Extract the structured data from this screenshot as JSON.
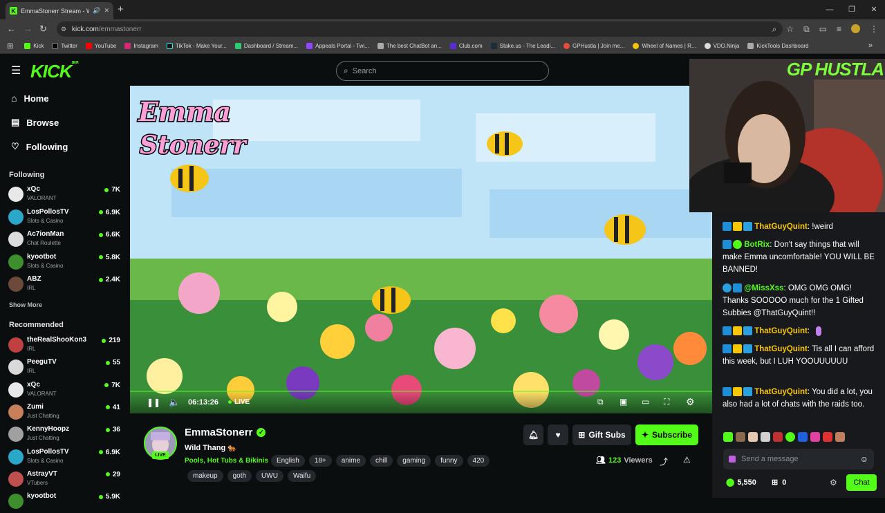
{
  "browser": {
    "tab_title": "EmmaStonerr Stream - Wat",
    "new_tab": "+",
    "url_host": "kick.com",
    "url_path": "/emmastonerr",
    "bookmarks": [
      "Kick",
      "Twitter",
      "YouTube",
      "Instagram",
      "TikTok - Make Your...",
      "Dashboard / Stream...",
      "Appeals Portal - Twi...",
      "The best ChatBot an...",
      "Club.com",
      "Stake.us - The Leadi...",
      "GPHustla | Join me...",
      "Wheel of Names | R...",
      "VDO.Ninja",
      "KickTools Dashboard"
    ]
  },
  "header": {
    "logo": "KICK",
    "logo_beta": "BETA",
    "search_placeholder": "Search"
  },
  "sidebar": {
    "nav": [
      {
        "label": "Home",
        "icon": "home-icon"
      },
      {
        "label": "Browse",
        "icon": "browse-icon"
      },
      {
        "label": "Following",
        "icon": "heart-icon"
      }
    ],
    "following_title": "Following",
    "following": [
      {
        "name": "xQc",
        "category": "VALORANT",
        "viewers": "7K",
        "color": "#e8e8e8"
      },
      {
        "name": "LosPollosTV",
        "category": "Slots & Casino",
        "viewers": "6.9K",
        "color": "#2aa7c9"
      },
      {
        "name": "Ac7ionMan",
        "category": "Chat Roulette",
        "viewers": "6.6K",
        "color": "#dddddd"
      },
      {
        "name": "kyootbot",
        "category": "Slots & Casino",
        "viewers": "5.8K",
        "color": "#3c8f2c"
      },
      {
        "name": "ABZ",
        "category": "IRL",
        "viewers": "2.4K",
        "color": "#6b4a3a"
      }
    ],
    "show_more": "Show More",
    "recommended_title": "Recommended",
    "recommended": [
      {
        "name": "theRealShooKon3",
        "category": "IRL",
        "viewers": "219",
        "color": "#c04040"
      },
      {
        "name": "PeeguTV",
        "category": "IRL",
        "viewers": "55",
        "color": "#d9d9d9"
      },
      {
        "name": "xQc",
        "category": "VALORANT",
        "viewers": "7K",
        "color": "#e8e8e8"
      },
      {
        "name": "Zumi",
        "category": "Just Chatting",
        "viewers": "41",
        "color": "#c8805a"
      },
      {
        "name": "KennyHoopz",
        "category": "Just Chatting",
        "viewers": "36",
        "color": "#a0a0a0"
      },
      {
        "name": "LosPollosTV",
        "category": "Slots & Casino",
        "viewers": "6.9K",
        "color": "#2aa7c9"
      },
      {
        "name": "AstrayVT",
        "category": "VTubers",
        "viewers": "29",
        "color": "#c05050"
      },
      {
        "name": "kyootbot",
        "category": "",
        "viewers": "5.9K",
        "color": "#3c8f2c"
      }
    ]
  },
  "player": {
    "time": "06:13:26",
    "live": "LIVE"
  },
  "overlay": {
    "webcam_text": "GP HUSTLA"
  },
  "stream": {
    "name": "EmmaStonerr",
    "title": "Wild Thang 🐅",
    "category": "Pools, Hot Tubs & Bikinis",
    "live_badge": "LIVE",
    "tags_row1": [
      "English",
      "18+",
      "anime",
      "chill",
      "gaming",
      "funny",
      "420"
    ],
    "tags_row2": [
      "makeup",
      "goth",
      "UWU",
      "Waifu"
    ],
    "viewers": "123",
    "viewers_label": "Viewers",
    "gift_label": "Gift Subs",
    "subscribe_label": "Subscribe"
  },
  "chat": {
    "messages": [
      {
        "user": "ThatGuyQuint",
        "color": "#f8c700",
        "text": "!weird"
      },
      {
        "user": "BotRix",
        "color": "#53fc18",
        "text": "Don't say things that will make Emma uncomfortable! YOU WILL BE BANNED!"
      },
      {
        "user": "@MissXss",
        "color": "#53fc18",
        "text": "OMG OMG OMG! Thanks SOOOOO much for the 1 Gifted Subbies @ThatGuyQuint!!"
      },
      {
        "user": "ThatGuyQuint",
        "color": "#f8c700",
        "text": ""
      },
      {
        "user": "ThatGuyQuint",
        "color": "#f8c700",
        "text": "Tis all I can afford this week, but I LUH YOOUUUUUU"
      },
      {
        "user": "ThatGuyQuint",
        "color": "#f8c700",
        "text": "You did a lot, you also had a lot of chats with the raids too."
      }
    ],
    "input_placeholder": "Send a message",
    "points": "5,550",
    "gifts": "0",
    "chat_button": "Chat"
  }
}
